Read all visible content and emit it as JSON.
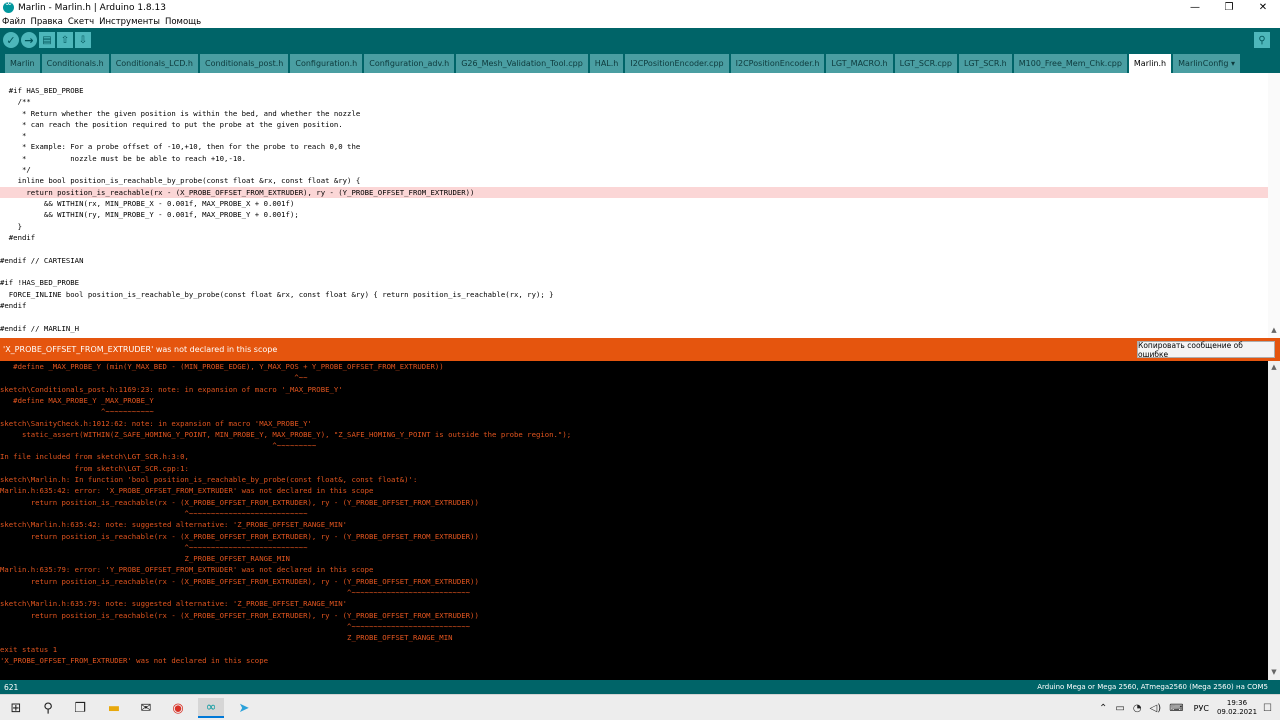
{
  "window": {
    "title": "Marlin - Marlin.h | Arduino 1.8.13",
    "minimize": "—",
    "maximize": "❐",
    "close": "✕"
  },
  "menu": [
    "Файл",
    "Правка",
    "Скетч",
    "Инструменты",
    "Помощь"
  ],
  "toolbar": {
    "verify": "✓",
    "upload": "→",
    "new": "▤",
    "open": "⇧",
    "save": "⇩",
    "serial_monitor": "⚲"
  },
  "tabs": [
    {
      "label": "Marlin",
      "active": false
    },
    {
      "label": "Conditionals.h",
      "active": false
    },
    {
      "label": "Conditionals_LCD.h",
      "active": false
    },
    {
      "label": "Conditionals_post.h",
      "active": false
    },
    {
      "label": "Configuration.h",
      "active": false
    },
    {
      "label": "Configuration_adv.h",
      "active": false
    },
    {
      "label": "G26_Mesh_Validation_Tool.cpp",
      "active": false
    },
    {
      "label": "HAL.h",
      "active": false
    },
    {
      "label": "I2CPositionEncoder.cpp",
      "active": false
    },
    {
      "label": "I2CPositionEncoder.h",
      "active": false
    },
    {
      "label": "LGT_MACRO.h",
      "active": false
    },
    {
      "label": "LGT_SCR.cpp",
      "active": false
    },
    {
      "label": "LGT_SCR.h",
      "active": false
    },
    {
      "label": "M100_Free_Mem_Chk.cpp",
      "active": false
    },
    {
      "label": "Marlin.h",
      "active": true
    }
  ],
  "tab_menu_label": "MarlinConfig ▾",
  "editor": {
    "lines": [
      {
        "text": "  #if HAS_BED_PROBE",
        "row": 1
      },
      {
        "text": "    /**",
        "row": 2
      },
      {
        "text": "     * Return whether the given position is within the bed, and whether the nozzle",
        "row": 3
      },
      {
        "text": "     * can reach the position required to put the probe at the given position.",
        "row": 4
      },
      {
        "text": "     *",
        "row": 5
      },
      {
        "text": "     * Example: For a probe offset of -10,+10, then for the probe to reach 0,0 the",
        "row": 6
      },
      {
        "text": "     *          nozzle must be be able to reach +10,-10.",
        "row": 7
      },
      {
        "text": "     */",
        "row": 8
      },
      {
        "text": "    inline bool position_is_reachable_by_probe(const float &rx, const float &ry) {",
        "row": 9
      },
      {
        "text": "      return position_is_reachable(rx - (X_PROBE_OFFSET_FROM_EXTRUDER), ry - (Y_PROBE_OFFSET_FROM_EXTRUDER))",
        "row": 10,
        "highlight": true
      },
      {
        "text": "          && WITHIN(rx, MIN_PROBE_X - 0.001f, MAX_PROBE_X + 0.001f)",
        "row": 11
      },
      {
        "text": "          && WITHIN(ry, MIN_PROBE_Y - 0.001f, MAX_PROBE_Y + 0.001f);",
        "row": 12
      },
      {
        "text": "    }",
        "row": 13
      },
      {
        "text": "  #endif",
        "row": 14
      },
      {
        "text": "#endif // CARTESIAN",
        "row": 16
      },
      {
        "text": "#if !HAS_BED_PROBE",
        "row": 18
      },
      {
        "text": "  FORCE_INLINE bool position_is_reachable_by_probe(const float &rx, const float &ry) { return position_is_reachable(rx, ry); }",
        "row": 19
      },
      {
        "text": "#endif",
        "row": 20
      },
      {
        "text": "#endif // MARLIN_H",
        "row": 22
      }
    ]
  },
  "error_bar": {
    "message": "'X_PROBE_OFFSET_FROM_EXTRUDER' was not declared in this scope",
    "copy_button": "Копировать сообщение об ошибке"
  },
  "console": {
    "lines": [
      "   #define _MAX_PROBE_Y (min(Y_MAX_BED - (MIN_PROBE_EDGE), Y_MAX_POS + Y_PROBE_OFFSET_FROM_EXTRUDER))",
      "                                                                   ^~~",
      "sketch\\Conditionals_post.h:1169:23: note: in expansion of macro '_MAX_PROBE_Y'",
      "   #define MAX_PROBE_Y _MAX_PROBE_Y",
      "                       ^~~~~~~~~~~~",
      "sketch\\SanityCheck.h:1012:62: note: in expansion of macro 'MAX_PROBE_Y'",
      "     static_assert(WITHIN(Z_SAFE_HOMING_Y_POINT, MIN_PROBE_Y, MAX_PROBE_Y), \"Z_SAFE_HOMING_Y_POINT is outside the probe region.\");",
      "                                                              ^~~~~~~~~~",
      "In file included from sketch\\LGT_SCR.h:3:0,",
      "                 from sketch\\LGT_SCR.cpp:1:",
      "sketch\\Marlin.h: In function 'bool position_is_reachable_by_probe(const float&, const float&)':",
      "Marlin.h:635:42: error: 'X_PROBE_OFFSET_FROM_EXTRUDER' was not declared in this scope",
      "       return position_is_reachable(rx - (X_PROBE_OFFSET_FROM_EXTRUDER), ry - (Y_PROBE_OFFSET_FROM_EXTRUDER))",
      "                                          ^~~~~~~~~~~~~~~~~~~~~~~~~~~~",
      "sketch\\Marlin.h:635:42: note: suggested alternative: 'Z_PROBE_OFFSET_RANGE_MIN'",
      "       return position_is_reachable(rx - (X_PROBE_OFFSET_FROM_EXTRUDER), ry - (Y_PROBE_OFFSET_FROM_EXTRUDER))",
      "                                          ^~~~~~~~~~~~~~~~~~~~~~~~~~~~",
      "                                          Z_PROBE_OFFSET_RANGE_MIN",
      "Marlin.h:635:79: error: 'Y_PROBE_OFFSET_FROM_EXTRUDER' was not declared in this scope",
      "       return position_is_reachable(rx - (X_PROBE_OFFSET_FROM_EXTRUDER), ry - (Y_PROBE_OFFSET_FROM_EXTRUDER))",
      "                                                                               ^~~~~~~~~~~~~~~~~~~~~~~~~~~~",
      "sketch\\Marlin.h:635:79: note: suggested alternative: 'Z_PROBE_OFFSET_RANGE_MIN'",
      "       return position_is_reachable(rx - (X_PROBE_OFFSET_FROM_EXTRUDER), ry - (Y_PROBE_OFFSET_FROM_EXTRUDER))",
      "                                                                               ^~~~~~~~~~~~~~~~~~~~~~~~~~~~",
      "                                                                               Z_PROBE_OFFSET_RANGE_MIN",
      "exit status 1",
      "'X_PROBE_OFFSET_FROM_EXTRUDER' was not declared in this scope"
    ]
  },
  "status_bar": {
    "line_number": "621",
    "board": "Arduino Mega or Mega 2560, ATmega2560 (Mega 2560) на COM5"
  },
  "taskbar": {
    "start": "⊞",
    "search": "⚲",
    "task_view": "❐",
    "explorer": "▬",
    "mail": "✉",
    "chrome": "◉",
    "arduino": "∞",
    "telegram": "➤",
    "tray_chevron": "⌃",
    "tray_network": "▭",
    "tray_wifi": "◔",
    "tray_volume": "◁)",
    "tray_keyboard": "⌨",
    "language": "РУС",
    "time": "19:36",
    "date": "09.02.2021",
    "notifications": "☐"
  },
  "colors": {
    "toolbar_bg": "#006468",
    "tab_bg": "#4a9ea2",
    "error_bar": "#e5550e",
    "console_text": "#e2551f",
    "highlight_line": "#fbd6d6"
  }
}
